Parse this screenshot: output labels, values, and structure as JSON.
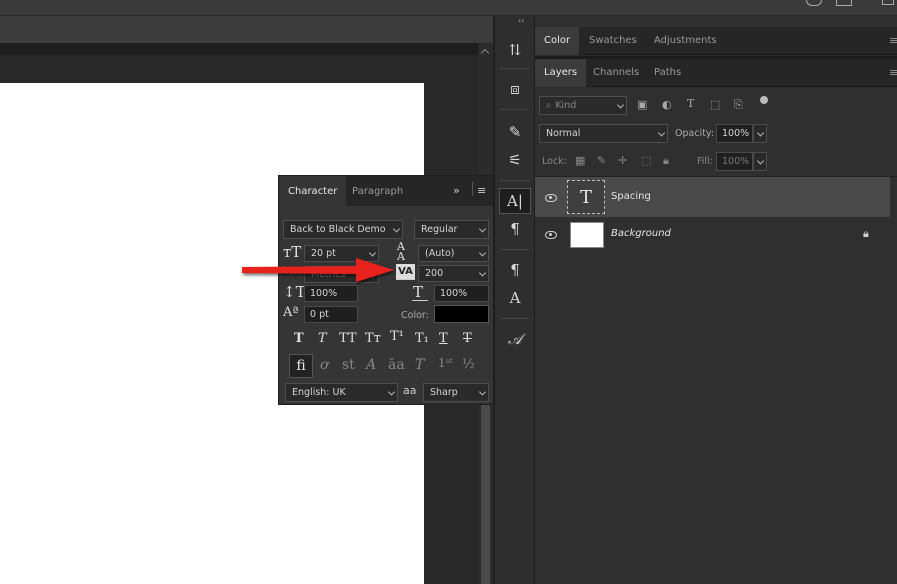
{
  "panels": {
    "top_tabs": [
      "Color",
      "Swatches",
      "Adjustments"
    ],
    "layer_tabs": [
      "Layers",
      "Channels",
      "Paths"
    ]
  },
  "layers_panel": {
    "filter_placeholder": "Kind",
    "blend_mode": "Normal",
    "opacity_label": "Opacity:",
    "opacity_value": "100%",
    "lock_label": "Lock:",
    "fill_label": "Fill:",
    "fill_value": "100%",
    "layers": [
      {
        "name": "Spacing",
        "type": "text",
        "selected": true
      },
      {
        "name": "Background",
        "type": "image",
        "locked": true
      }
    ]
  },
  "character_panel": {
    "tabs": [
      "Character",
      "Paragraph"
    ],
    "font_family": "Back to Black Demo",
    "font_style": "Regular",
    "font_size": "20 pt",
    "leading": "(Auto)",
    "kerning": "Metrics",
    "tracking": "200",
    "vertical_scale": "100%",
    "horizontal_scale": "100%",
    "baseline_shift": "0 pt",
    "color_label": "Color:",
    "color_value": "#000000",
    "language": "English: UK",
    "antialias": "Sharp",
    "aa_label": "aa"
  },
  "colors": {
    "arrow": "#e8201e",
    "canvas": "#ffffff",
    "selected_layer": "#4a4a4a"
  }
}
